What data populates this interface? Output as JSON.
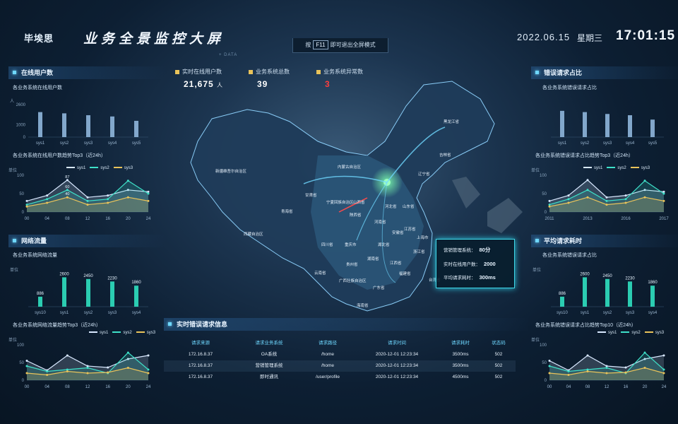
{
  "header": {
    "logo": "毕埃思",
    "title": "业务全景监控大屏",
    "date": "2022.06.15",
    "weekday": "星期三",
    "time": "17:01:15",
    "hint": {
      "pre": "按",
      "key": "F11",
      "post": "即可退出全屏模式"
    },
    "data_tag": "+ DATA"
  },
  "stats": [
    {
      "label": "实时在线用户数",
      "value": "21,675",
      "unit": "人"
    },
    {
      "label": "业务系统总数",
      "value": "39",
      "unit": ""
    },
    {
      "label": "业务系统异常数",
      "value": "3",
      "unit": ""
    }
  ],
  "left": {
    "online": {
      "title": "在线用户数",
      "sub": "各业务系统在线用户数",
      "unit": "人",
      "trend_sub": "各业务系统在线用户数趋势Top3（近24h）",
      "trend_unit": "单位"
    },
    "traffic": {
      "title": "网络流量",
      "sub": "各业务系统网络流量",
      "unit": "单位",
      "trend_sub": "各业务系统网络流量趋势Top3（近24h）",
      "trend_unit": "单位"
    }
  },
  "right": {
    "errors": {
      "title": "错误请求占比",
      "sub": "各业务系统错误请求占比",
      "trend_sub": "各业务系统错误请求占比趋势Top3（近24h）",
      "trend_unit": "单位"
    },
    "latency": {
      "title": "平均请求耗时",
      "sub": "各业务系统错误请求占比",
      "unit": "单位",
      "trend_sub": "各业务系统错误请求占比趋势Top10（近24h）",
      "trend_unit": "单位"
    }
  },
  "popup": {
    "rows": [
      {
        "label": "营销管理系统：",
        "value": "80分"
      },
      {
        "label": "实时在线用户数：",
        "value": "2000"
      },
      {
        "label": "平均请求耗时：",
        "value": "300ms"
      }
    ]
  },
  "table": {
    "title": "实时错误请求信息",
    "headers": [
      "请求来源",
      "请求业务系统",
      "请求路径",
      "请求时间",
      "请求耗时",
      "状态码"
    ],
    "rows": [
      [
        "172.16.8.37",
        "OA系统",
        "/home",
        "2020-12-01 12:23:34",
        "3500ms",
        "502"
      ],
      [
        "172.16.8.37",
        "营销管理系统",
        "/home",
        "2020-12-01 12:23:34",
        "3500ms",
        "502"
      ],
      [
        "172.16.8.37",
        "即时通讯",
        "/user/profile",
        "2020-12-01 12:23:34",
        "4500ms",
        "502"
      ]
    ]
  },
  "provinces": [
    "黑龙江省",
    "吉林省",
    "辽宁省",
    "内蒙古自治区",
    "新疆维吾尔自治区",
    "甘肃省",
    "青海省",
    "宁夏回族自治区",
    "山西省",
    "河北省",
    "山东省",
    "河南省",
    "江苏省",
    "安徽省",
    "上海市",
    "陕西省",
    "四川省",
    "重庆市",
    "湖北省",
    "浙江省",
    "西藏自治区",
    "湖南省",
    "江西省",
    "福建省",
    "贵州省",
    "云南省",
    "广西壮族自治区",
    "广东省",
    "台湾省",
    "海南省"
  ],
  "chart_data": [
    {
      "id": "online-bar",
      "type": "bar",
      "categories": [
        "sys1",
        "sys2",
        "sys3",
        "sys4",
        "sys5"
      ],
      "values": [
        2000,
        1900,
        1750,
        1650,
        1300
      ],
      "ylim": [
        0,
        2600
      ],
      "yticks": [
        "0",
        "1000",
        "2600"
      ]
    },
    {
      "id": "online-trend",
      "type": "line",
      "x": [
        "00",
        "04",
        "08",
        "12",
        "16",
        "20",
        "24"
      ],
      "yticks": [
        "0",
        "50",
        "100"
      ],
      "ylim": [
        0,
        100
      ],
      "series": [
        {
          "name": "sys1",
          "color": "#d8e8ff",
          "values": [
            30,
            45,
            87,
            40,
            45,
            60,
            55
          ]
        },
        {
          "name": "sys2",
          "color": "#3ee0c8",
          "values": [
            20,
            35,
            60,
            30,
            35,
            85,
            50
          ]
        },
        {
          "name": "sys3",
          "color": "#e9c35a",
          "values": [
            15,
            25,
            40,
            20,
            25,
            40,
            30
          ]
        }
      ],
      "labels": [
        "87",
        "60",
        "40"
      ]
    },
    {
      "id": "traffic-bar",
      "type": "bar",
      "categories": [
        "sys10",
        "sys1",
        "sys2",
        "sys3",
        "sys4"
      ],
      "values": [
        886,
        2600,
        2450,
        2230,
        1860
      ],
      "ylim": [
        0,
        3000
      ]
    },
    {
      "id": "traffic-trend",
      "type": "line",
      "x": [
        "00",
        "04",
        "08",
        "12",
        "16",
        "20",
        "24"
      ],
      "yticks": [
        "0",
        "50",
        "100"
      ],
      "ylim": [
        0,
        100
      ],
      "series": [
        {
          "name": "sys1",
          "color": "#d8e8ff",
          "values": [
            55,
            28,
            70,
            40,
            36,
            60,
            70
          ]
        },
        {
          "name": "sys2",
          "color": "#3ee0c8",
          "values": [
            40,
            25,
            30,
            35,
            20,
            78,
            30
          ]
        },
        {
          "name": "sys3",
          "color": "#e9c35a",
          "values": [
            20,
            15,
            25,
            20,
            22,
            35,
            20
          ]
        }
      ]
    },
    {
      "id": "error-bar",
      "type": "bar",
      "categories": [
        "sys1",
        "sys2",
        "sys3",
        "sys4",
        "sys5"
      ],
      "values": [
        2100,
        2000,
        1850,
        1750,
        1400
      ],
      "ylim": [
        0,
        2600
      ]
    },
    {
      "id": "error-trend",
      "type": "line",
      "x": [
        "2011",
        "2013",
        "2016",
        "2017"
      ],
      "yticks": [
        "0",
        "50",
        "100"
      ],
      "ylim": [
        0,
        100
      ],
      "series": [
        {
          "name": "sys1",
          "color": "#d8e8ff",
          "values": [
            30,
            45,
            87,
            40,
            45,
            60,
            55
          ]
        },
        {
          "name": "sys2",
          "color": "#3ee0c8",
          "values": [
            20,
            35,
            60,
            30,
            35,
            85,
            50
          ]
        },
        {
          "name": "sys3",
          "color": "#e9c35a",
          "values": [
            15,
            25,
            40,
            20,
            25,
            40,
            30
          ]
        }
      ]
    },
    {
      "id": "latency-bar",
      "type": "bar",
      "categories": [
        "sys10",
        "sys1",
        "sys2",
        "sys3",
        "sys4"
      ],
      "values": [
        886,
        2600,
        2450,
        2230,
        1860
      ],
      "ylim": [
        0,
        3000
      ]
    },
    {
      "id": "latency-trend",
      "type": "line",
      "x": [
        "00",
        "04",
        "08",
        "12",
        "16",
        "20",
        "24"
      ],
      "yticks": [
        "0",
        "50",
        "100"
      ],
      "ylim": [
        0,
        100
      ],
      "series": [
        {
          "name": "sys1",
          "color": "#d8e8ff",
          "values": [
            55,
            28,
            70,
            40,
            36,
            60,
            70
          ]
        },
        {
          "name": "sys2",
          "color": "#3ee0c8",
          "values": [
            40,
            25,
            30,
            35,
            20,
            78,
            30
          ]
        },
        {
          "name": "sys3",
          "color": "#e9c35a",
          "values": [
            20,
            15,
            25,
            20,
            22,
            35,
            20
          ]
        }
      ]
    }
  ]
}
